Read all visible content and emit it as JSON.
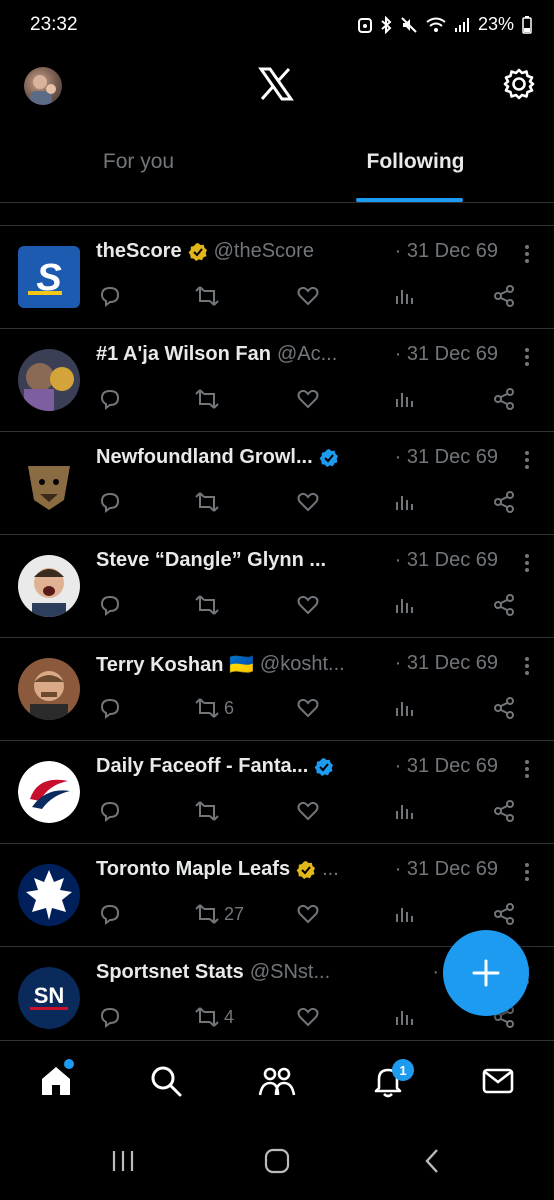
{
  "status": {
    "time": "23:32",
    "battery": "23%"
  },
  "header": {
    "logo": "x-logo-icon",
    "settings_icon": "gear-icon"
  },
  "tabs": [
    {
      "label": "For you",
      "active": false
    },
    {
      "label": "Following",
      "active": true
    }
  ],
  "posts": [
    {
      "name": "theScore",
      "badge": "gold",
      "handle": "@theScore",
      "date": "· 31 Dec 69",
      "retweets": ""
    },
    {
      "name": "#1 A'ja Wilson Fan",
      "badge": "",
      "handle": "@Ac...",
      "date": "· 31 Dec 69",
      "retweets": ""
    },
    {
      "name": "Newfoundland Growl...",
      "badge": "blue",
      "handle": "",
      "date": "· 31 Dec 69",
      "retweets": ""
    },
    {
      "name": "Steve “Dangle” Glynn ...",
      "badge": "",
      "handle": "",
      "date": "· 31 Dec 69",
      "retweets": ""
    },
    {
      "name": "Terry Koshan 🇺🇦",
      "badge": "",
      "handle": "@kosht...",
      "date": "· 31 Dec 69",
      "retweets": "6"
    },
    {
      "name": "Daily Faceoff - Fanta...",
      "badge": "blue",
      "handle": "",
      "date": "· 31 Dec 69",
      "retweets": ""
    },
    {
      "name": "Toronto Maple Leafs",
      "badge": "gold",
      "handle": "...",
      "date": "· 31 Dec 69",
      "retweets": "27"
    },
    {
      "name": "Sportsnet Stats",
      "badge": "",
      "handle": "@SNst...",
      "date": "· 31 De",
      "retweets": "4"
    }
  ],
  "bottom_nav": {
    "notifications_count": "1"
  },
  "colors": {
    "accent": "#1d9bf0",
    "gold_badge": "#e2b719",
    "muted": "#71767b",
    "divider": "#2f3336"
  }
}
